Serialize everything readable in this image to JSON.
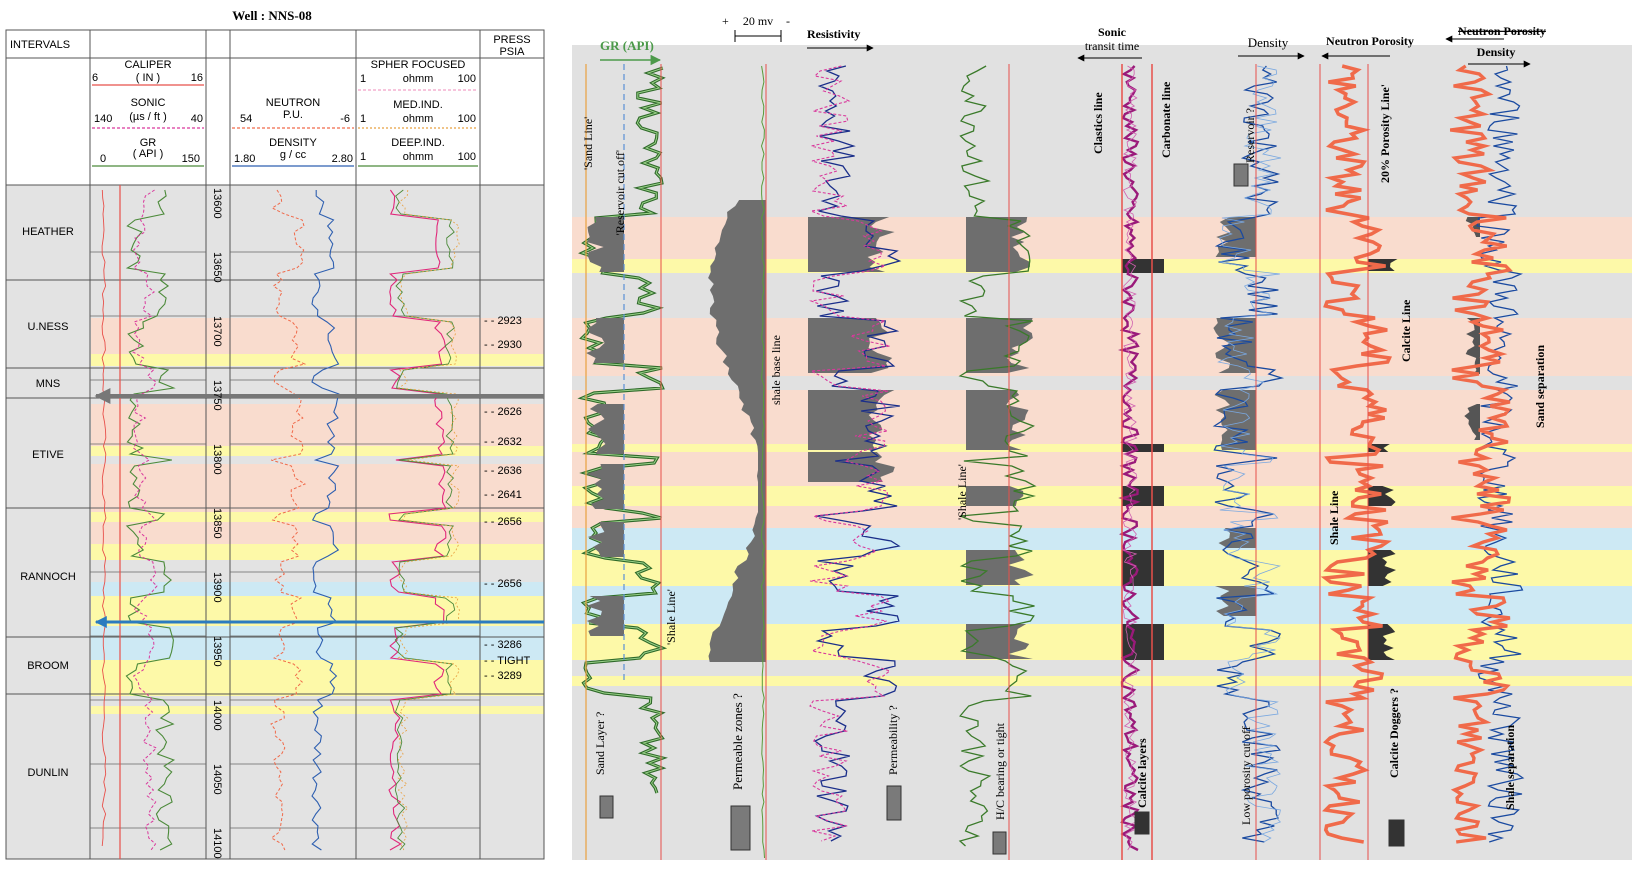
{
  "title": "Well : NNS-08",
  "header": {
    "intervals": "INTERVALS",
    "press_1": "PRESS",
    "press_2": "PSIA",
    "caliper": "CALIPER",
    "caliper_min": "6",
    "caliper_unit": "( IN )",
    "caliper_max": "16",
    "sonic": "SONIC",
    "sonic_min": "140",
    "sonic_unit": "(µs / ft )",
    "sonic_max": "40",
    "gr": "GR",
    "gr_unit": "( API )",
    "gr_min": "0",
    "gr_max": "150",
    "neutron": "NEUTRON",
    "neutron_unit": "P.U.",
    "neutron_min": "54",
    "neutron_max": "-6",
    "density": "DENSITY",
    "density_unit": "g / cc",
    "density_min": "1.80",
    "density_max": "2.80",
    "spher": "SPHER FOCUSED",
    "spher_min": "1",
    "spher_unit": "ohmm",
    "spher_max": "100",
    "med": "MED.IND.",
    "med_min": "1",
    "med_unit": "ohmm",
    "med_max": "100",
    "deep": "DEEP.IND.",
    "deep_min": "1",
    "deep_unit": "ohmm",
    "deep_max": "100"
  },
  "intervals": [
    "HEATHER",
    "U.NESS",
    "MNS",
    "ETIVE",
    "RANNOCH",
    "BROOM",
    "DUNLIN"
  ],
  "depths": [
    "13600",
    "13650",
    "13700",
    "13750",
    "13800",
    "13850",
    "13900",
    "13950",
    "14000",
    "14050",
    "14100"
  ],
  "pressures": [
    "2923",
    "2930",
    "2626",
    "2632",
    "2636",
    "2641",
    "2656",
    "2656",
    "3286",
    "TIGHT",
    "3289"
  ],
  "panels": {
    "gr": {
      "header": "GR (API)",
      "sand_line": "'Sand Line'",
      "reservoir_cutoff": "'Reservoir cut off'",
      "shale_line": "'Shale Line'",
      "legend": "Sand Layer ?"
    },
    "sp": {
      "scale_plus": "+",
      "scale_value": "20 mv",
      "scale_minus": "-",
      "base_line": "shale base line",
      "legend": "Permeable zones ?"
    },
    "resistivity": {
      "header": "Resistivity",
      "legend": "Permeability ?"
    },
    "shale": {
      "shale_line": "'Shale Line'",
      "legend": "H/C bearing or tight"
    },
    "sonic": {
      "header_1": "Sonic",
      "header_2": "transit time",
      "clastics_line": "Clastics line",
      "carbonate_line": "Carbonate line",
      "legend": "Calcite layers"
    },
    "density": {
      "header": "Density",
      "reservoir": "Reservoir ?",
      "legend": "Low porosity cut off"
    },
    "neutron": {
      "header": "Neutron Porosity",
      "porosity_line": "20% Porosity Line'",
      "calcite_line": "Calcite Line",
      "shale_line": "Shale Line",
      "legend": "Calcite Doggers ?"
    },
    "overlay": {
      "header_1": "Neutron Porosity",
      "header_2": "Density",
      "sand_separation": "Sand separation",
      "shale_separation": "Shale separation"
    }
  },
  "colors": {
    "background_gray": "#e1e1e1",
    "sand_peach": "#f9dcce",
    "calcite_yellow": "#fdf9a8",
    "blue_zone": "#cde9f4",
    "gr_green": "#4c8a3a",
    "caliper_red": "#e8504a",
    "sonic_magenta": "#d9389c",
    "density_blue": "#2e5fb0",
    "neutron_orange": "#f06a4a",
    "fill_gray": "#6e6e6e"
  }
}
